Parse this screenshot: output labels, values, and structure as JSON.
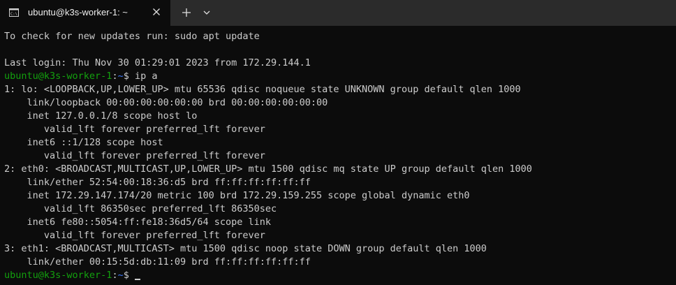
{
  "tab": {
    "title": "ubuntu@k3s-worker-1: ~"
  },
  "terminal": {
    "prompt_user": "ubuntu@k3s-worker-1",
    "prompt_sep": ":",
    "prompt_path": "~",
    "prompt_symbol": "$ ",
    "command": "ip a",
    "lines": [
      "To check for new updates run: sudo apt update",
      "",
      "Last login: Thu Nov 30 01:29:01 2023 from 172.29.144.1"
    ],
    "output": [
      "1: lo: <LOOPBACK,UP,LOWER_UP> mtu 65536 qdisc noqueue state UNKNOWN group default qlen 1000",
      "    link/loopback 00:00:00:00:00:00 brd 00:00:00:00:00:00",
      "    inet 127.0.0.1/8 scope host lo",
      "       valid_lft forever preferred_lft forever",
      "    inet6 ::1/128 scope host",
      "       valid_lft forever preferred_lft forever",
      "2: eth0: <BROADCAST,MULTICAST,UP,LOWER_UP> mtu 1500 qdisc mq state UP group default qlen 1000",
      "    link/ether 52:54:00:18:36:d5 brd ff:ff:ff:ff:ff:ff",
      "    inet 172.29.147.174/20 metric 100 brd 172.29.159.255 scope global dynamic eth0",
      "       valid_lft 86350sec preferred_lft 86350sec",
      "    inet6 fe80::5054:ff:fe18:36d5/64 scope link",
      "       valid_lft forever preferred_lft forever",
      "3: eth1: <BROADCAST,MULTICAST> mtu 1500 qdisc noop state DOWN group default qlen 1000",
      "    link/ether 00:15:5d:db:11:09 brd ff:ff:ff:ff:ff:ff"
    ]
  },
  "colors": {
    "background": "#0c0c0c",
    "tabbar": "#2b2b2b",
    "text": "#cccccc",
    "prompt_user": "#13a10e",
    "prompt_path": "#3b78ff"
  }
}
